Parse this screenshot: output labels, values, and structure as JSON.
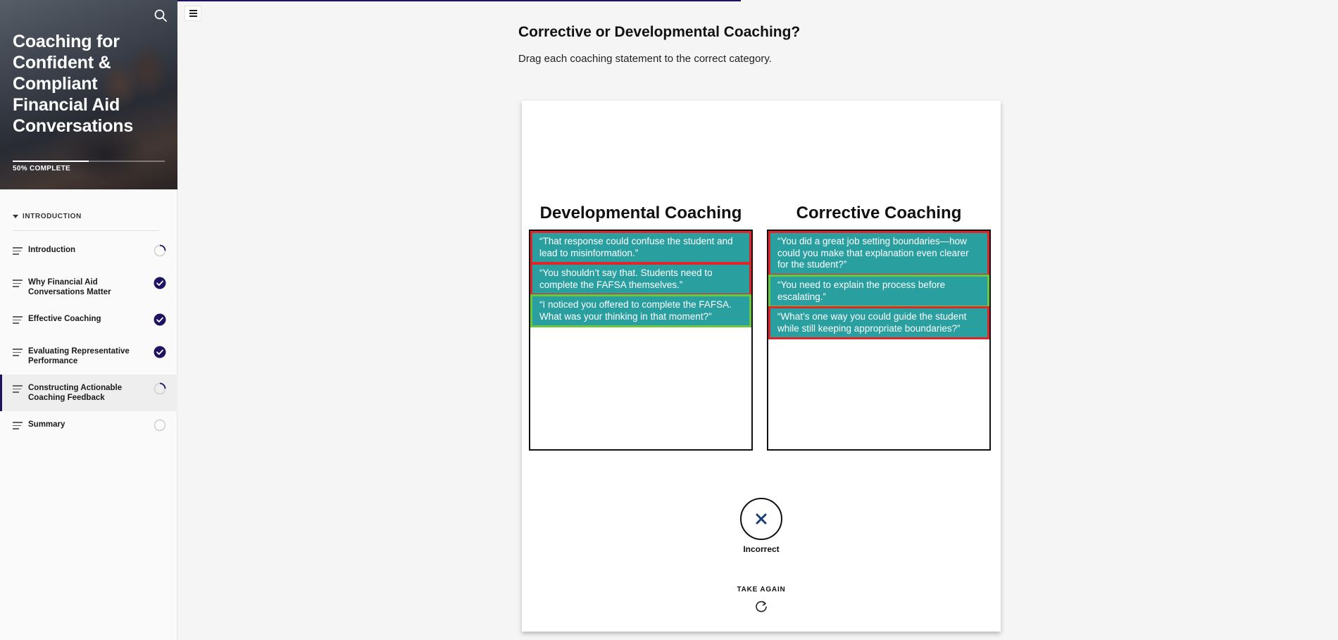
{
  "course": {
    "title": "Coaching for Confident & Compliant Financial Aid Conversations",
    "progress_label": "50% COMPLETE",
    "progress_fraction": 0.5
  },
  "sidebar": {
    "section": "INTRODUCTION",
    "items": [
      {
        "label": "Introduction",
        "status": "in-progress"
      },
      {
        "label": "Why Financial Aid Conversations Matter",
        "status": "complete"
      },
      {
        "label": "Effective Coaching",
        "status": "complete"
      },
      {
        "label": "Evaluating Representative Performance",
        "status": "complete"
      },
      {
        "label": "Constructing Actionable Coaching Feedback",
        "status": "in-progress",
        "active": true
      },
      {
        "label": "Summary",
        "status": "not-started"
      }
    ]
  },
  "lesson": {
    "heading": "Corrective or Developmental Coaching?",
    "instructions": "Drag each coaching statement to the correct category."
  },
  "activity": {
    "categories": [
      {
        "title": "Developmental Coaching",
        "statements": [
          {
            "text": "“That response could confuse the student and lead to misinformation.”",
            "correct": false
          },
          {
            "text": "“You shouldn’t say that. Students need to complete the FAFSA themselves.”",
            "correct": false
          },
          {
            "text": "“I noticed you offered to complete the FAFSA. What was your thinking in that moment?”",
            "correct": true
          }
        ]
      },
      {
        "title": "Corrective Coaching",
        "statements": [
          {
            "text": "“You did a great job setting boundaries—how could you make that explanation even clearer for the student?”",
            "correct": false
          },
          {
            "text": "“You need to explain the process before escalating.”",
            "correct": true
          },
          {
            "text": "“What’s one way you could guide the student while still keeping appropriate boundaries?”",
            "correct": false
          }
        ]
      }
    ],
    "result_label": "Incorrect",
    "retry_label": "TAKE AGAIN"
  },
  "colors": {
    "accent": "#1c1463",
    "tile": "#2a9fa0",
    "incorrect_border": "#e0262b",
    "correct_border": "#6ac83f"
  },
  "icons": {
    "search": "search-icon",
    "menu": "menu-icon",
    "complete": "check-circle-icon",
    "in_progress": "progress-ring-icon",
    "not_started": "empty-circle-icon",
    "result": "x-icon",
    "retry": "refresh-icon"
  }
}
